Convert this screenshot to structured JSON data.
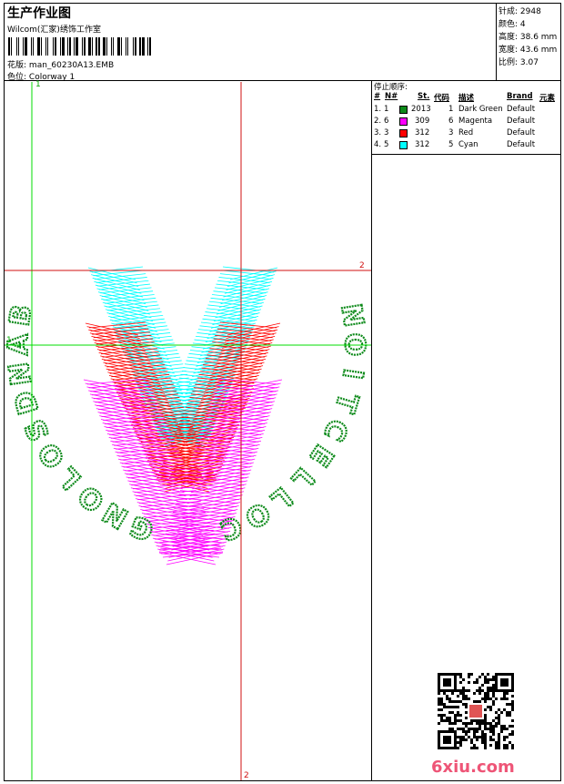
{
  "header": {
    "title": "生产作业图",
    "subtitle": "Wilcom(汇家)绣饰工作室",
    "design_label": "花版:",
    "design_value": "man_60230A13.EMB",
    "colorway_label": "色位:",
    "colorway_value": "Colorway 1"
  },
  "stats": {
    "stitches": "针成: 2948",
    "colors": "颜色: 4",
    "height": "高度: 38.6 mm",
    "width": "宽度: 43.6 mm",
    "ratio": "比例: 3.07"
  },
  "stop_sequence": {
    "title": "停止顺序:",
    "headers": {
      "num": "#",
      "no": "N#",
      "st": "St.",
      "code": "代码",
      "desc": "描述",
      "brand": "Brand",
      "element": "元素"
    },
    "rows": [
      {
        "num": "1.",
        "no": "1",
        "color": "#0d8a1a",
        "st": "2013",
        "code": "1",
        "desc": "Dark Green",
        "brand": "Default"
      },
      {
        "num": "2.",
        "no": "6",
        "color": "#ff00ff",
        "st": "309",
        "code": "6",
        "desc": "Magenta",
        "brand": "Default"
      },
      {
        "num": "3.",
        "no": "3",
        "color": "#ff0000",
        "st": "312",
        "code": "3",
        "desc": "Red",
        "brand": "Default"
      },
      {
        "num": "4.",
        "no": "5",
        "color": "#00ffff",
        "st": "312",
        "code": "5",
        "desc": "Cyan",
        "brand": "Default"
      }
    ]
  },
  "guides": {
    "green_vertical": "1",
    "green_horizontal": "1",
    "red_horizontal": "2",
    "red_vertical": "2"
  },
  "design_text": {
    "left": "BANDSOLONG",
    "right": "COLLECTION"
  },
  "watermark": "6xiu.com",
  "colors": {
    "green": "#0d8a1a",
    "magenta": "#ff00ff",
    "red": "#ff0000",
    "cyan": "#00ffff"
  }
}
